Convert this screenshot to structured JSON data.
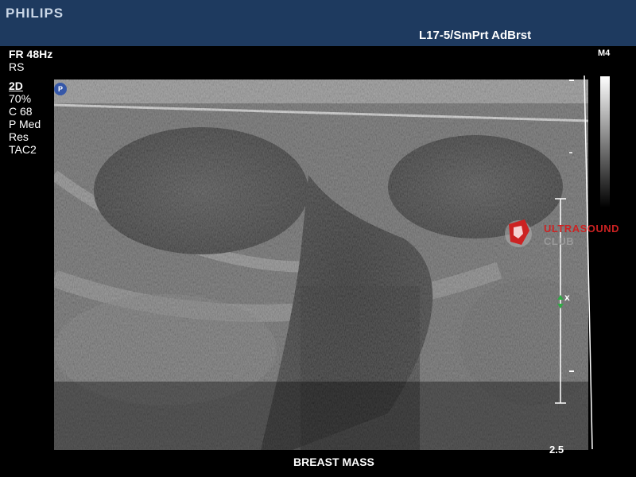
{
  "header": {
    "brand": "PHILIPS",
    "probe": "L17-5/SmPrt AdBrst"
  },
  "params": {
    "frame_rate": "FR 48Hz",
    "mode_rs": "RS",
    "mode": "2D",
    "gain": " 70%",
    "compression": "C 68",
    "persistence": "P Med",
    "resolution": "Res",
    "tac": "TAC2"
  },
  "map_label": "M4",
  "focus_marker": "P",
  "depth": "2.5",
  "caption": "BREAST  MASS",
  "watermark": {
    "line1": "ULTRASOUND",
    "line2": "CLUB",
    "color": "#cc2222"
  },
  "caliper_label": "x"
}
